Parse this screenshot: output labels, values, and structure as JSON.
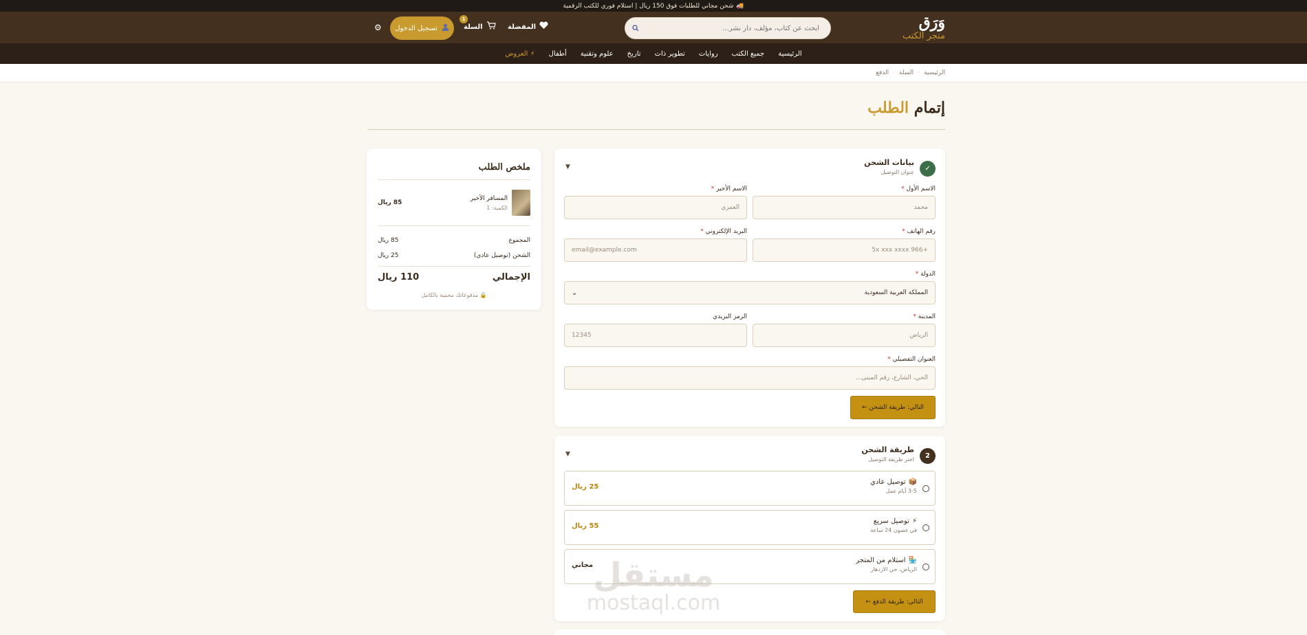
{
  "topbar": {
    "icon": "🚚",
    "text": "شحن مجاني للطلبات فوق 150 ريال | استلام فوري للكتب الرقمية"
  },
  "brand": {
    "logo": "وَرَق",
    "subtitle": "متجر الكتب"
  },
  "search": {
    "placeholder": "ابحث عن كتاب، مؤلف، دار نشر..."
  },
  "header": {
    "favorites_label": "المفضلة",
    "cart_label": "السلة",
    "cart_count": "1",
    "login_label": "تسجيل الدخول"
  },
  "nav": {
    "items": [
      "الرئيسية",
      "جميع الكتب",
      "روايات",
      "تطوير ذات",
      "تاريخ",
      "علوم وتقنية",
      "أطفال"
    ],
    "offers": "العروض"
  },
  "breadcrumb": [
    "الرئيسية",
    "السلة",
    "الدفع"
  ],
  "page_title": {
    "part1": "إتمام",
    "part2": "الطلب"
  },
  "summary": {
    "title": "ملخص الطلب",
    "item_name": "المسافر الأخير",
    "item_qty": "الكمية: 1",
    "item_price": "85 ريال",
    "subtotal_label": "المجموع",
    "subtotal_value": "85 ريال",
    "shipping_label": "الشحن (توصيل عادي)",
    "shipping_value": "25 ريال",
    "total_label": "الإجمالي",
    "total_value": "110 ريال",
    "secure_note": "🔒 مدفوعاتك محمية بالكامل"
  },
  "shipping_step": {
    "number": "✓",
    "title": "بيانات الشحن",
    "subtitle": "عنوان التوصيل",
    "first_name_label": "الاسم الأول",
    "first_name_placeholder": "محمد",
    "last_name_label": "الاسم الأخير",
    "last_name_placeholder": "العمري",
    "phone_label": "رقم الهاتف",
    "phone_placeholder": "+966 5x xxx xxxx",
    "email_label": "البريد الإلكتروني",
    "email_placeholder": "email@example.com",
    "country_label": "الدولة",
    "country_value": "المملكة العربية السعودية",
    "city_label": "المدينة",
    "city_placeholder": "الرياض",
    "zip_label": "الرمز البريدي",
    "zip_placeholder": "12345",
    "address_label": "العنوان التفصيلي",
    "address_placeholder": "الحي، الشارع، رقم المبنى...",
    "next_button": "التالي: طريقة الشحن ←"
  },
  "method_step": {
    "number": "2",
    "title": "طريقة الشحن",
    "subtitle": "اختر طريقة التوصيل",
    "options": [
      {
        "icon": "📦",
        "name": "توصيل عادي",
        "desc": "3-5 أيام عمل",
        "price": "25 ريال"
      },
      {
        "icon": "⚡",
        "name": "توصيل سريع",
        "desc": "في غضون 24 ساعة",
        "price": "55 ريال"
      },
      {
        "icon": "🏪",
        "name": "استلام من المتجر",
        "desc": "الرياض، حي الازدهار",
        "price": "مجاني"
      }
    ],
    "next_button": "التالي: طريقة الدفع ←"
  },
  "watermark": {
    "arabic": "مستقل",
    "latin": "mostaql.com"
  },
  "colors": {
    "accent": "#c99a2e",
    "header_bg": "#43301f",
    "nav_bg": "#2d2018",
    "success": "#3c6e47"
  }
}
